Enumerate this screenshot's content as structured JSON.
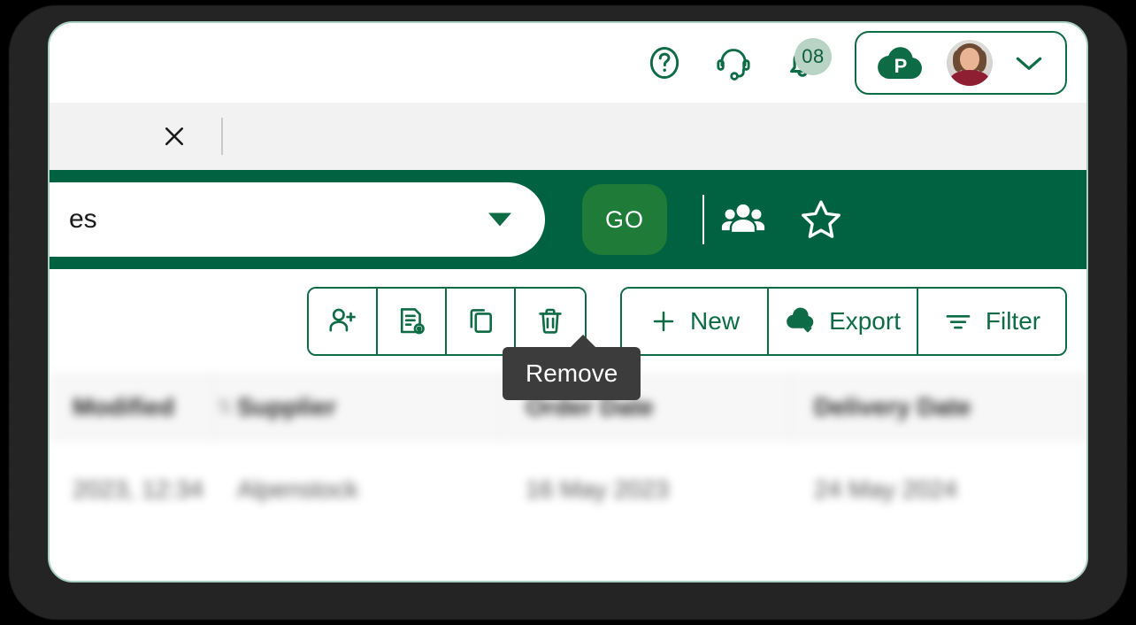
{
  "colors": {
    "brand_green": "#006241",
    "brand_green_dark": "#0d6b46",
    "go_green": "#1e7b38",
    "badge_bg": "#b9d4c4",
    "tooltip_bg": "#3c3c3c",
    "tabstrip_bg": "#f2f2f2",
    "panel_border": "#a8cfc1"
  },
  "appbar": {
    "help_icon": "question-circle-icon",
    "support_icon": "headset-icon",
    "notifications_icon": "bell-icon",
    "notifications_count": "08",
    "brand_logo": "cloud-p-logo",
    "avatar": "user-avatar",
    "chevron": "chevron-down-icon"
  },
  "tabstrip": {
    "close_label": "×",
    "close_icon": "close-icon"
  },
  "search": {
    "value": "es",
    "dropdown_icon": "caret-down-icon",
    "go_label": "GO",
    "share_icon": "people-group-icon",
    "favorite_icon": "star-outline-icon"
  },
  "toolbar": {
    "icon_buttons": [
      {
        "name": "assign-user-button",
        "icon": "person-add-icon"
      },
      {
        "name": "view-document-button",
        "icon": "document-preview-icon"
      },
      {
        "name": "duplicate-button",
        "icon": "copy-icon"
      },
      {
        "name": "remove-button",
        "icon": "trash-icon"
      }
    ],
    "text_buttons": [
      {
        "name": "new-button",
        "icon": "plus-icon",
        "label": "New"
      },
      {
        "name": "export-button",
        "icon": "cloud-download-icon",
        "label": "Export"
      },
      {
        "name": "filter-button",
        "icon": "filter-icon",
        "label": "Filter"
      }
    ]
  },
  "tooltip": {
    "text": "Remove"
  },
  "table": {
    "columns": [
      {
        "label": "Modified",
        "sort_icon": "sort-icon"
      },
      {
        "label": "Supplier",
        "sort_icon": ""
      },
      {
        "label": "Order Date",
        "sort_icon": ""
      },
      {
        "label": "Delivery Date",
        "sort_icon": ""
      }
    ],
    "rows": [
      {
        "modified": "2023, 12:34",
        "supplier": "Alpenstock",
        "order_date": "16 May 2023",
        "delivery_date": "24 May 2024"
      }
    ]
  }
}
